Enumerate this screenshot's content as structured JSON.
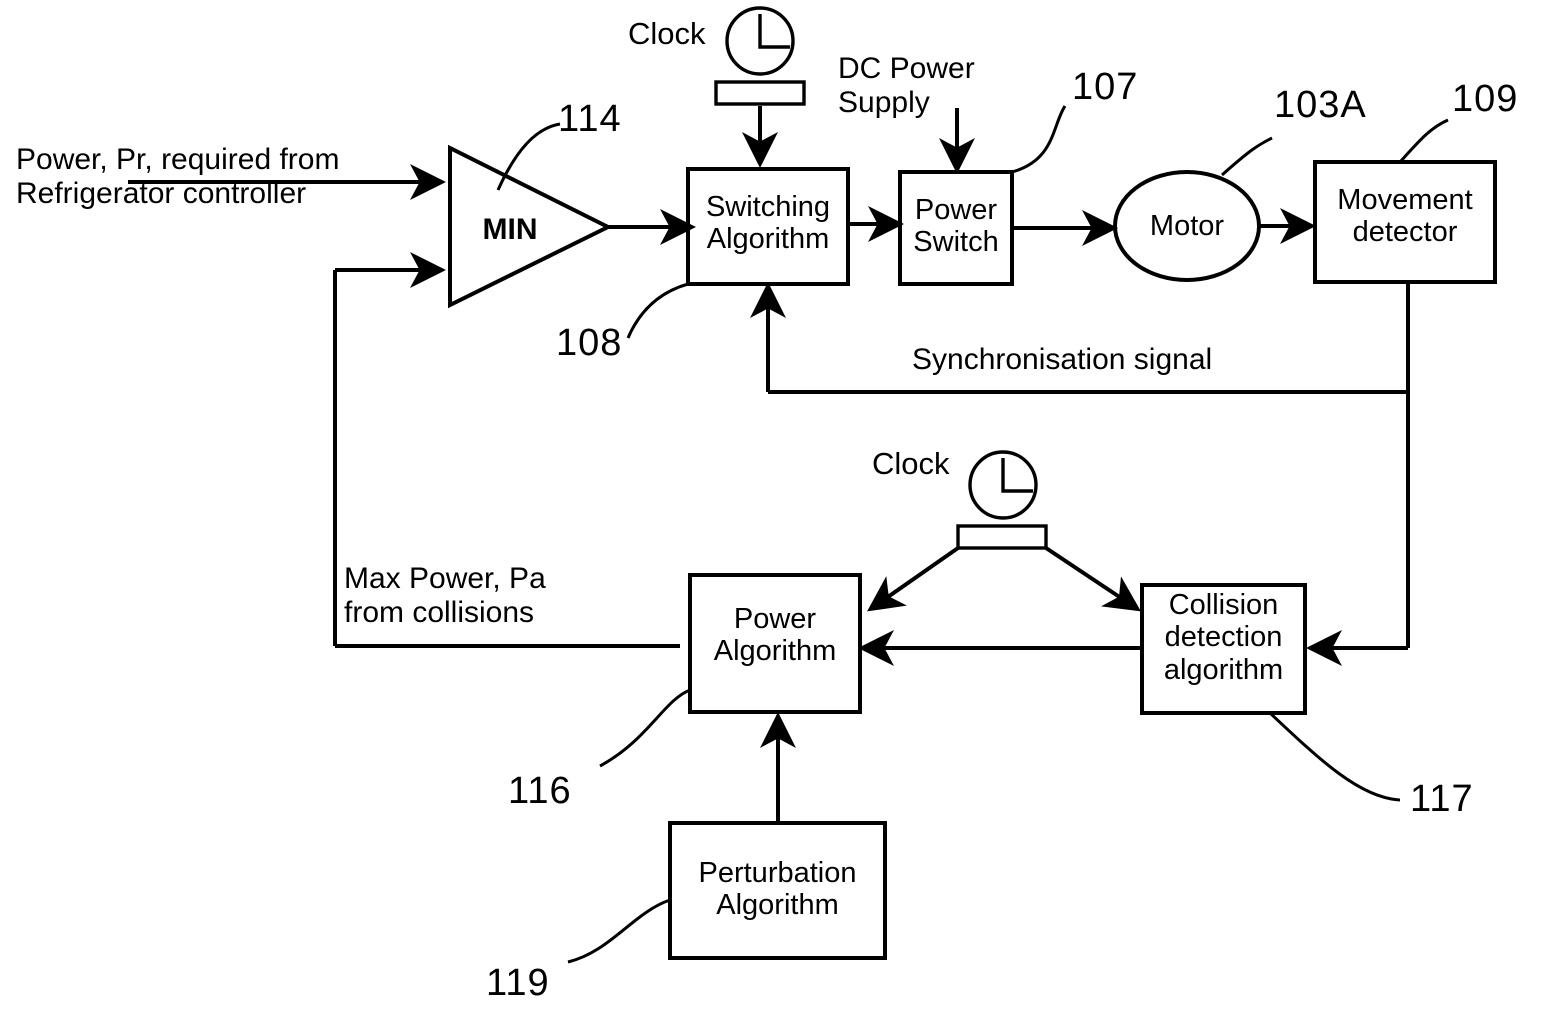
{
  "figure": {
    "type": "patent-block-diagram",
    "title": "Refrigerator compressor motor control block diagram"
  },
  "inputs": {
    "power_required": "Power, Pr, required from\nRefrigerator controller",
    "clock_top": "Clock",
    "dc_power_supply": "DC Power\nSupply",
    "clock_mid": "Clock"
  },
  "blocks": {
    "min": {
      "label": "MIN",
      "ref": "114",
      "shape": "triangle"
    },
    "switching": {
      "label": "Switching\nAlgorithm",
      "ref": "108",
      "shape": "rect"
    },
    "power_switch": {
      "label": "Power\nSwitch",
      "ref": "107",
      "shape": "rect"
    },
    "motor": {
      "label": "Motor",
      "ref": "103A",
      "shape": "ellipse"
    },
    "movement_detector": {
      "label": "Movement\ndetector",
      "ref": "109",
      "shape": "rect"
    },
    "power_algorithm": {
      "label": "Power\nAlgorithm",
      "ref": "116",
      "shape": "rect"
    },
    "collision_detection": {
      "label": "Collision\ndetection\nalgorithm",
      "ref": "117",
      "shape": "rect"
    },
    "perturbation": {
      "label": "Perturbation\nAlgorithm",
      "ref": "119",
      "shape": "rect"
    }
  },
  "signals": {
    "synchronisation": "Synchronisation signal",
    "max_power": "Max Power, Pa\nfrom collisions"
  },
  "reference_numerals": [
    "114",
    "108",
    "107",
    "103A",
    "109",
    "116",
    "117",
    "119"
  ],
  "colors": {
    "ink": "#000000",
    "background": "#ffffff"
  }
}
